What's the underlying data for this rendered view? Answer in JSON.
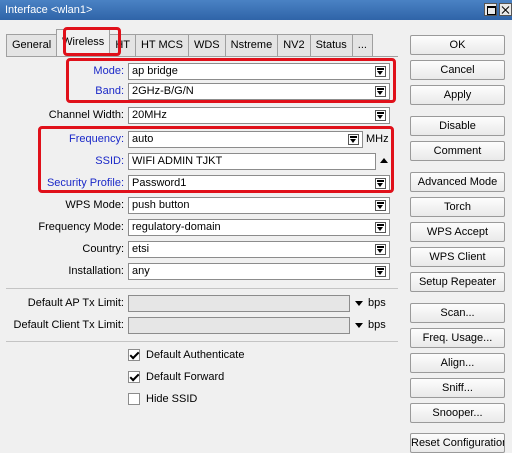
{
  "window": {
    "title": "Interface <wlan1>"
  },
  "tabs": [
    "General",
    "Wireless",
    "HT",
    "HT MCS",
    "WDS",
    "Nstreme",
    "NV2",
    "Status",
    "..."
  ],
  "fields": {
    "mode": {
      "label": "Mode:",
      "value": "ap bridge"
    },
    "band": {
      "label": "Band:",
      "value": "2GHz-B/G/N"
    },
    "channel_width": {
      "label": "Channel Width:",
      "value": "20MHz"
    },
    "frequency": {
      "label": "Frequency:",
      "value": "auto",
      "unit": "MHz"
    },
    "ssid": {
      "label": "SSID:",
      "value": "WIFI ADMIN TJKT"
    },
    "security_profile": {
      "label": "Security Profile:",
      "value": "Password1"
    },
    "wps_mode": {
      "label": "WPS Mode:",
      "value": "push button"
    },
    "frequency_mode": {
      "label": "Frequency Mode:",
      "value": "regulatory-domain"
    },
    "country": {
      "label": "Country:",
      "value": "etsi"
    },
    "installation": {
      "label": "Installation:",
      "value": "any"
    },
    "default_ap_tx_limit": {
      "label": "Default AP Tx Limit:",
      "value": "",
      "unit": "bps"
    },
    "default_client_tx_limit": {
      "label": "Default Client Tx Limit:",
      "value": "",
      "unit": "bps"
    }
  },
  "checkboxes": {
    "default_authenticate": {
      "label": "Default Authenticate",
      "checked": true
    },
    "default_forward": {
      "label": "Default Forward",
      "checked": true
    },
    "hide_ssid": {
      "label": "Hide SSID",
      "checked": false
    }
  },
  "buttons": {
    "ok": "OK",
    "cancel": "Cancel",
    "apply": "Apply",
    "disable": "Disable",
    "comment": "Comment",
    "advanced_mode": "Advanced Mode",
    "torch": "Torch",
    "wps_accept": "WPS Accept",
    "wps_client": "WPS Client",
    "setup_repeater": "Setup Repeater",
    "scan": "Scan...",
    "freq_usage": "Freq. Usage...",
    "align": "Align...",
    "sniff": "Sniff...",
    "snooper": "Snooper...",
    "reset_configuration": "Reset Configuration"
  },
  "colors": {
    "highlight": "#e0101a",
    "label_blue": "#1a28c8",
    "titlebar": "#3a6fb0"
  }
}
